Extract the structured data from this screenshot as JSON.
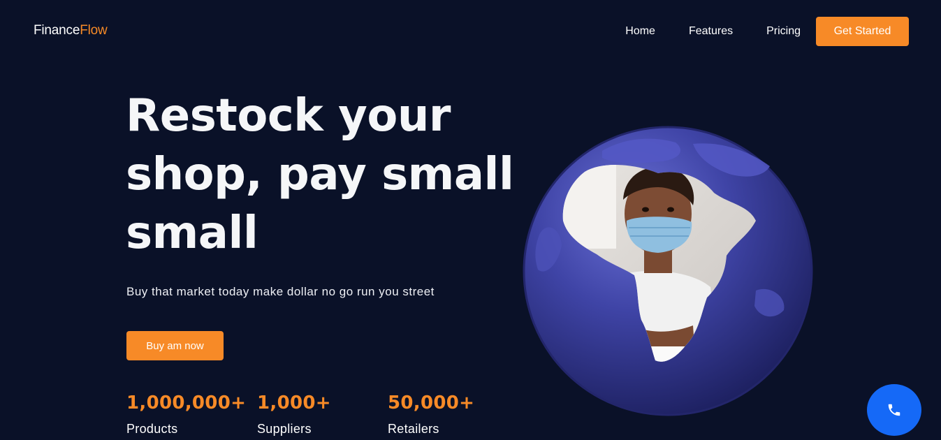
{
  "brand": {
    "name_primary": "Finance",
    "name_accent": "Flow"
  },
  "nav": {
    "items": [
      {
        "label": "Home"
      },
      {
        "label": "Features"
      },
      {
        "label": "Pricing"
      }
    ],
    "cta_label": "Get Started"
  },
  "hero": {
    "title_lines": [
      "Restock your",
      "shop, pay small",
      "small"
    ],
    "subtitle": "Buy that market today make dollar no go run you street",
    "button_label": "Buy am now",
    "image_icon": "globe-with-child-photo"
  },
  "stats": [
    {
      "value": "1,000,000+",
      "label": "Products"
    },
    {
      "value": "1,000+",
      "label": "Suppliers"
    },
    {
      "value": "50,000+",
      "label": "Retailers"
    }
  ],
  "call_button": {
    "icon": "phone-icon"
  },
  "colors": {
    "background": "#0a1128",
    "accent": "#f78a27",
    "call_button": "#1569f7",
    "globe": "#3a3f9e"
  }
}
